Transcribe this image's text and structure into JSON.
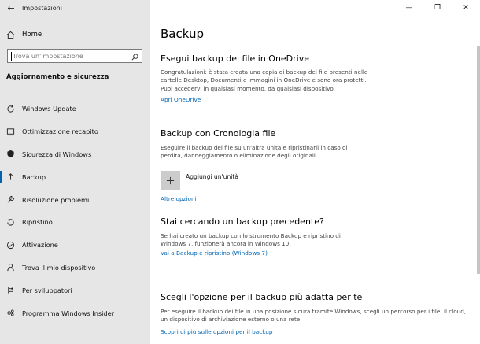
{
  "window": {
    "title": "Impostazioni",
    "back": "←",
    "minimize": "—",
    "maximize": "❐",
    "close": "✕"
  },
  "sidebar": {
    "home_label": "Home",
    "search_placeholder": "Trova un'impostazione",
    "section_heading": "Aggiornamento e sicurezza",
    "items": [
      {
        "label": "Windows Update",
        "icon": "sync-icon"
      },
      {
        "label": "Ottimizzazione recapito",
        "icon": "delivery-icon"
      },
      {
        "label": "Sicurezza di Windows",
        "icon": "shield-icon"
      },
      {
        "label": "Backup",
        "icon": "arrow-up-icon"
      },
      {
        "label": "Risoluzione problemi",
        "icon": "wrench-icon"
      },
      {
        "label": "Ripristino",
        "icon": "recovery-icon"
      },
      {
        "label": "Attivazione",
        "icon": "check-circle-icon"
      },
      {
        "label": "Trova il mio dispositivo",
        "icon": "person-pin-icon"
      },
      {
        "label": "Per sviluppatori",
        "icon": "developer-icon"
      },
      {
        "label": "Programma Windows Insider",
        "icon": "insider-icon"
      }
    ],
    "active_index": 3
  },
  "main": {
    "title": "Backup",
    "onedrive": {
      "heading": "Esegui backup dei file in OneDrive",
      "body": "Congratulazioni: è stata creata una copia di backup dei file presenti nelle cartelle Desktop, Documenti e Immagini in OneDrive e sono ora protetti. Puoi accedervi in qualsiasi momento, da qualsiasi dispositivo.",
      "link": "Apri OneDrive"
    },
    "history": {
      "heading": "Backup con Cronologia file",
      "body": "Eseguire il backup dei file su un'altra unità e ripristinarli in caso di perdita, danneggiamento o eliminazione degli originali.",
      "add_label": "Aggiungi un'unità",
      "more_link": "Altre opzioni"
    },
    "older": {
      "heading": "Stai cercando un backup precedente?",
      "body": "Se hai creato un backup con lo strumento Backup e ripristino di Windows 7, funzionerà ancora in Windows 10.",
      "link": "Vai a Backup e ripristino (Windows 7)"
    },
    "choose": {
      "heading": "Scegli l'opzione per il backup più adatta per te",
      "body": "Per eseguire il backup dei file in una posizione sicura tramite Windows, scegli un percorso per i file: il cloud, un dispositivo di archiviazione esterno o una rete.",
      "link": "Scopri di più sulle opzioni per il backup"
    }
  },
  "colors": {
    "accent": "#0063b1",
    "link": "#0066b4",
    "sidebar_bg": "#e6e6e6"
  }
}
